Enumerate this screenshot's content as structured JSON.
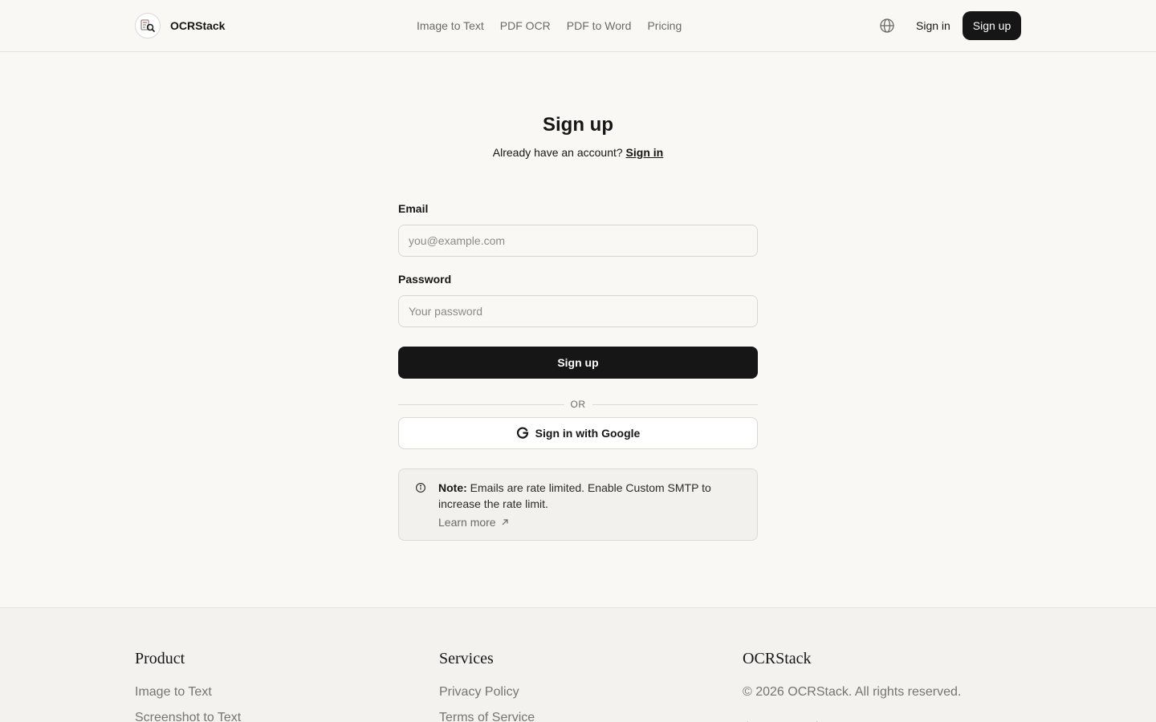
{
  "header": {
    "brand": "OCRStack",
    "nav": [
      "Image to Text",
      "PDF OCR",
      "PDF to Word",
      "Pricing"
    ],
    "sign_in": "Sign in",
    "sign_up": "Sign up"
  },
  "main": {
    "title": "Sign up",
    "subtitle": "Already have an account?",
    "subtitle_link": "Sign in",
    "email_label": "Email",
    "email_placeholder": "you@example.com",
    "password_label": "Password",
    "password_placeholder": "Your password",
    "submit": "Sign up",
    "divider": "OR",
    "google": "Sign in with Google",
    "note_label": "Note:",
    "note_text": "Emails are rate limited. Enable Custom SMTP to increase the rate limit.",
    "note_link": "Learn more"
  },
  "footer": {
    "product": {
      "heading": "Product",
      "links": [
        "Image to Text",
        "Screenshot to Text"
      ]
    },
    "services": {
      "heading": "Services",
      "links": [
        "Privacy Policy",
        "Terms of Service"
      ]
    },
    "company": {
      "heading": "OCRStack",
      "copyright": "© 2026 OCRStack. All rights reserved."
    }
  },
  "colors": {
    "background": "#f9f8f5",
    "primary": "#161616",
    "muted_text": "#6b6a66",
    "border": "#d9d7d2",
    "footer_bg": "#f3f2ee"
  }
}
